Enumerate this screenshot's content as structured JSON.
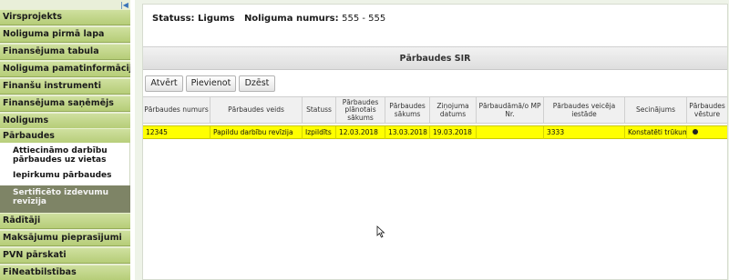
{
  "sidebar": {
    "collapse_icon": "double-left-chevron-icon",
    "items": [
      {
        "label": "Virsprojekts"
      },
      {
        "label": "Noliguma pirmā lapa"
      },
      {
        "label": "Finansējuma tabula"
      },
      {
        "label": "Noliguma pamatinformācija"
      },
      {
        "label": "Finanšu instrumenti"
      },
      {
        "label": "Finansējuma saņēmējs"
      },
      {
        "label": "Noligums"
      },
      {
        "label": "Pārbaudes"
      },
      {
        "label": "Rādītāji"
      },
      {
        "label": "Maksājumu pieprasījumi"
      },
      {
        "label": "PVN pārskati"
      },
      {
        "label": "FiNeatbilstības"
      }
    ],
    "submenu": [
      {
        "label": "Attiecināmo darbību pārbaudes uz vietas"
      },
      {
        "label": "Iepirkumu pārbaudes"
      },
      {
        "label": "Sertificēto izdevumu revīzija"
      }
    ]
  },
  "status": {
    "label": "Statuss:",
    "value": "Ligums",
    "number_label": "Noliguma numurs:",
    "number_value": "555",
    "separator": " - ",
    "number_suffix": "555"
  },
  "section": {
    "title": "Pārbaudes SIR"
  },
  "toolbar": {
    "open": "Atvērt",
    "add": "Pievienot",
    "delete": "Dzēst"
  },
  "table": {
    "columns": [
      "Pārbaudes numurs",
      "Pārbaudes veids",
      "Statuss",
      "Pārbaudes plānotais sākums",
      "Pārbaudes sākums",
      "Ziņojuma datums",
      "Pārbaudāmā/o MP Nr.",
      "Pārbaudes veicēja iestāde",
      "Secinājums",
      "Pārbaudes vēsture"
    ],
    "rows": [
      {
        "number": "12345",
        "type": "Papildu darbību revīzija",
        "status": "Izpildīts",
        "planned_start": "12.03.2018",
        "start": "13.03.2018",
        "report_date": "19.03.2018",
        "mp_nr": "",
        "institution": "3333",
        "conclusion": "Konstatēti trūkumi",
        "history_icon": "history-dot-icon"
      }
    ],
    "highlight_color": "#ffff00"
  },
  "colors": {
    "sidebar_item": "#c3d68a",
    "sidebar_active_sub": "#7e8466",
    "main_bg": "#eef3e8"
  }
}
